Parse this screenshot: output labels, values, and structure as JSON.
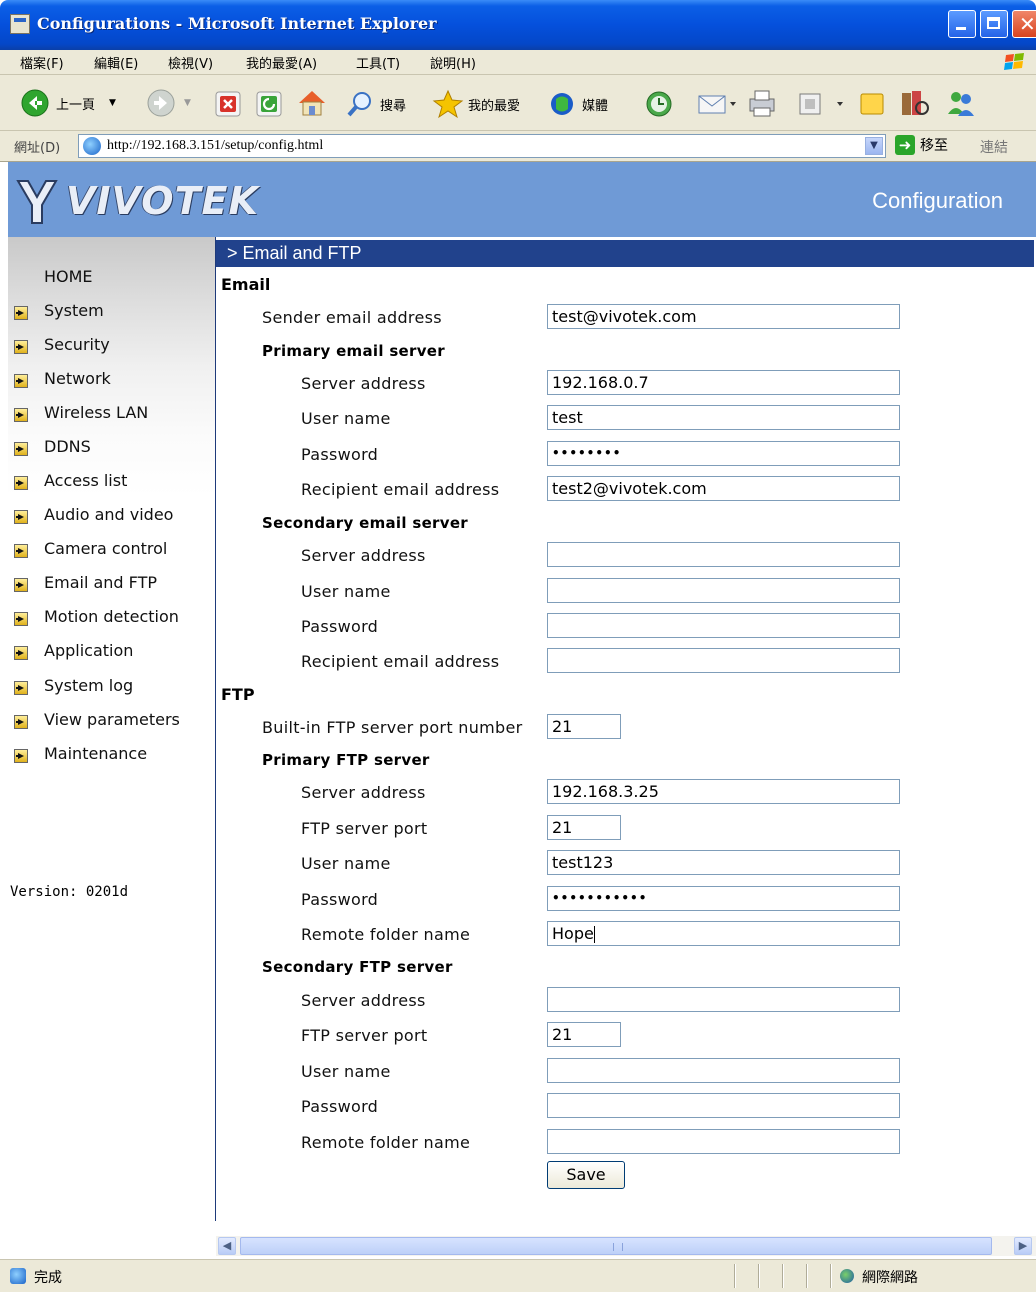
{
  "window": {
    "title": "Configurations - Microsoft Internet Explorer"
  },
  "menubar": {
    "items": [
      "檔案(F)",
      "編輯(E)",
      "檢視(V)",
      "我的最愛(A)",
      "工具(T)",
      "說明(H)"
    ]
  },
  "toolbar": {
    "back_label": "上一頁",
    "search_label": "搜尋",
    "favorites_label": "我的最愛",
    "media_label": "媒體"
  },
  "addressbar": {
    "label": "網址(D)",
    "url": "http://192.168.3.151/setup/config.html",
    "go_label": "移至",
    "links_label": "連結"
  },
  "header": {
    "logo": "VIVOTEK",
    "title": "Configuration"
  },
  "sidebar": {
    "home": "HOME",
    "items": [
      "System",
      "Security",
      "Network",
      "Wireless LAN",
      "DDNS",
      "Access list",
      "Audio and video",
      "Camera control",
      "Email and FTP",
      "Motion detection",
      "Application",
      "System log",
      "View parameters",
      "Maintenance"
    ],
    "version": "Version: 0201d"
  },
  "section": {
    "title": "> Email and FTP"
  },
  "email": {
    "heading": "Email",
    "sender_label": "Sender email address",
    "sender_value": "test@vivotek.com",
    "primary": {
      "heading": "Primary email server",
      "server_label": "Server address",
      "server_value": "192.168.0.7",
      "user_label": "User name",
      "user_value": "test",
      "password_label": "Password",
      "password_value": "••••••••",
      "recipient_label": "Recipient email address",
      "recipient_value": "test2@vivotek.com"
    },
    "secondary": {
      "heading": "Secondary email server",
      "server_label": "Server address",
      "server_value": "",
      "user_label": "User name",
      "user_value": "",
      "password_label": "Password",
      "password_value": "",
      "recipient_label": "Recipient email address",
      "recipient_value": ""
    }
  },
  "ftp": {
    "heading": "FTP",
    "builtin_port_label": "Built-in FTP server port number",
    "builtin_port_value": "21",
    "primary": {
      "heading": "Primary FTP server",
      "server_label": "Server address",
      "server_value": "192.168.3.25",
      "port_label": "FTP server port",
      "port_value": "21",
      "user_label": "User name",
      "user_value": "test123",
      "password_label": "Password",
      "password_value": "•••••••••••",
      "folder_label": "Remote folder name",
      "folder_value": "Hope"
    },
    "secondary": {
      "heading": "Secondary FTP server",
      "server_label": "Server address",
      "server_value": "",
      "port_label": "FTP server port",
      "port_value": "21",
      "user_label": "User name",
      "user_value": "",
      "password_label": "Password",
      "password_value": "",
      "folder_label": "Remote folder name",
      "folder_value": ""
    }
  },
  "save_label": "Save",
  "statusbar": {
    "status": "完成",
    "zone": "網際網路"
  },
  "colors": {
    "titlebar": "#0550dc",
    "header_bg": "#6f9ad6",
    "section_bar": "#21428c",
    "chrome": "#ece9d8"
  }
}
